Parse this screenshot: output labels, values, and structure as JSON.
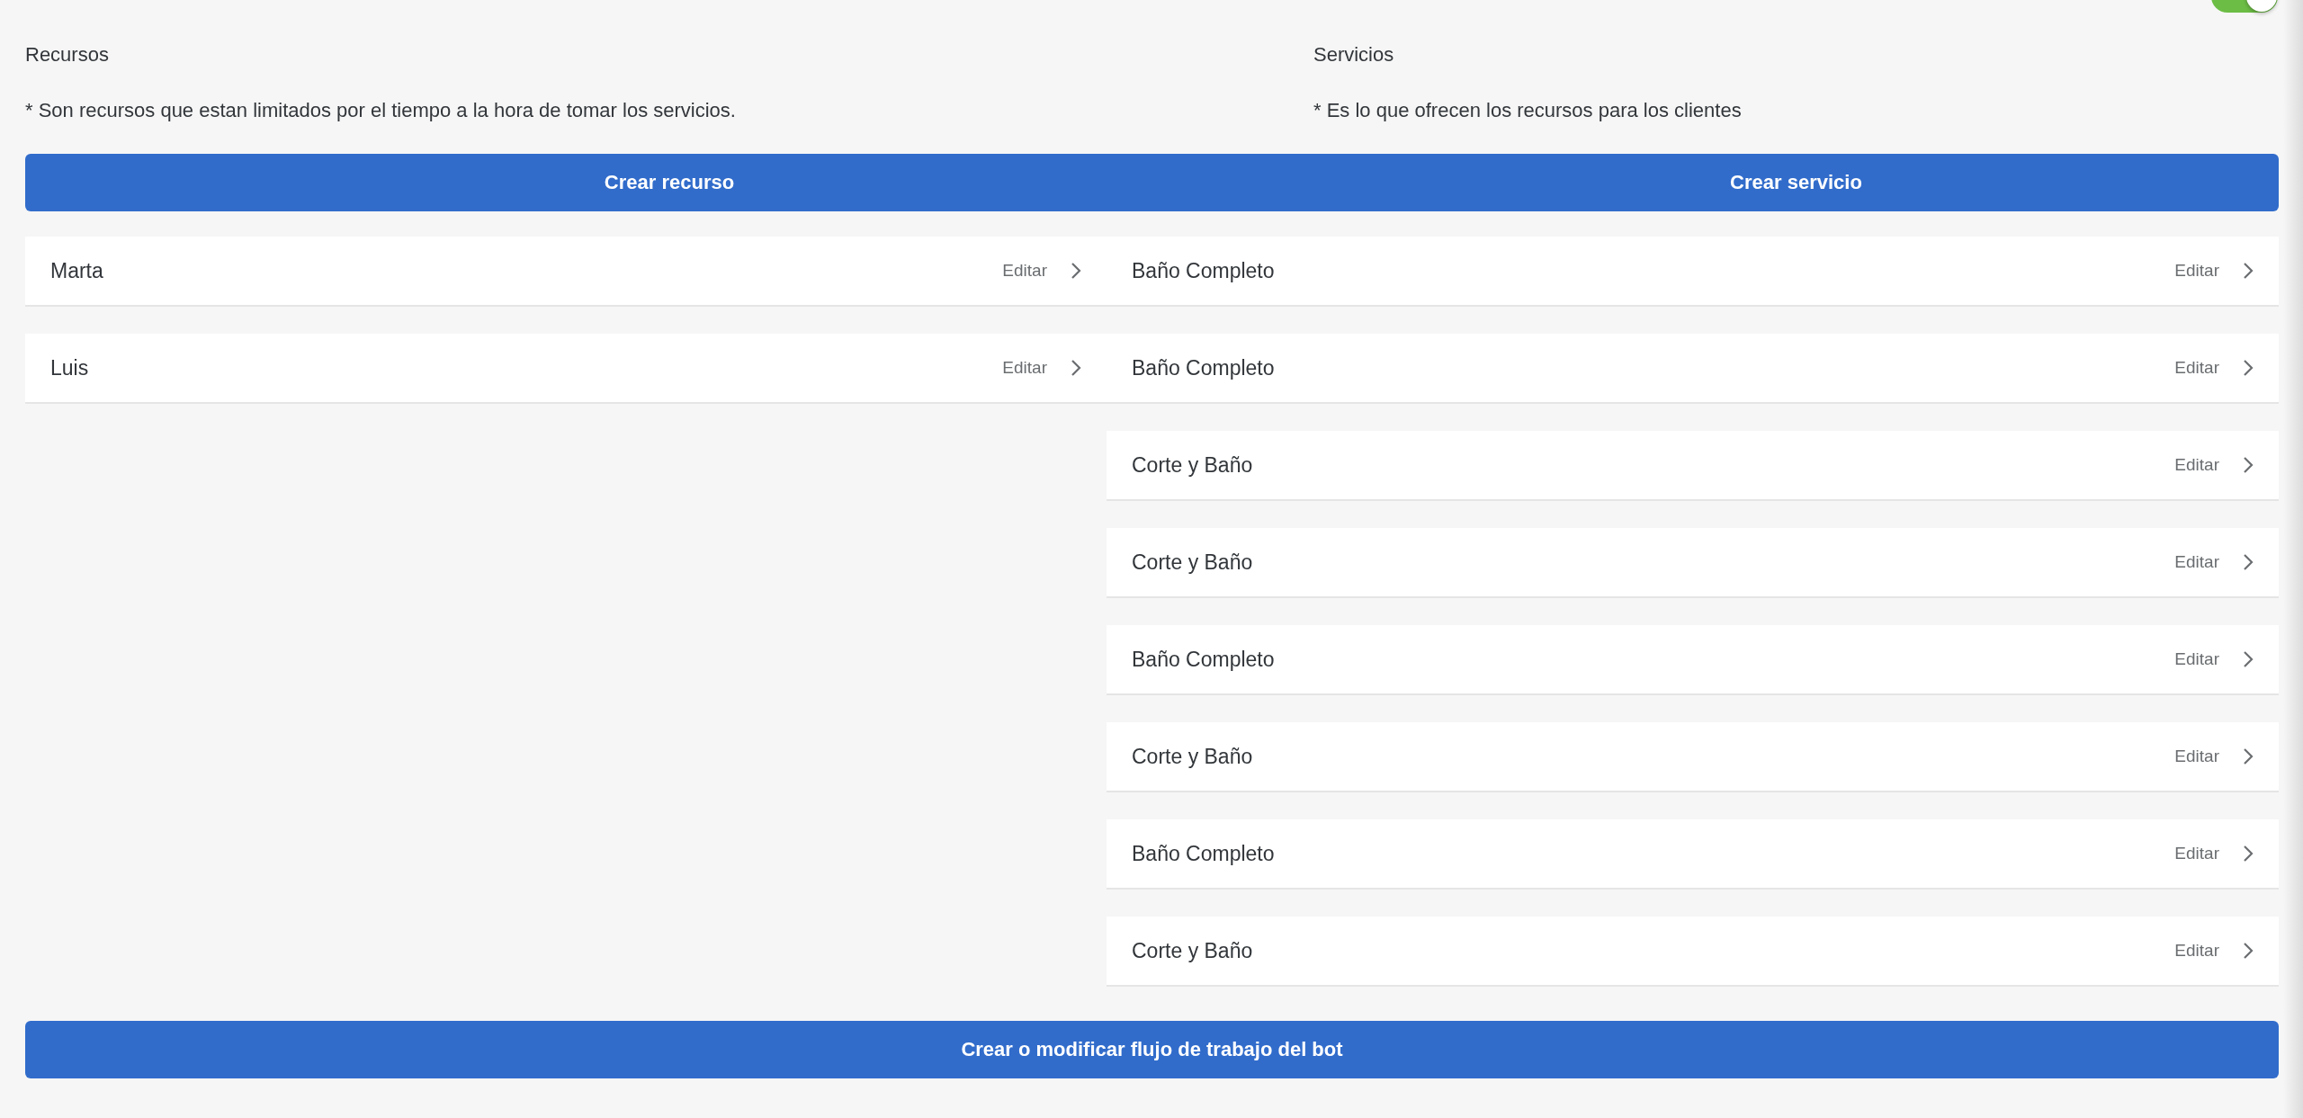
{
  "toggle": {
    "on": true
  },
  "resources": {
    "title": "Recursos",
    "note": "* Son recursos que estan limitados por el tiempo a la hora de tomar los servicios.",
    "create_button": "Crear recurso",
    "items": [
      {
        "name": "Marta",
        "action": "Editar"
      },
      {
        "name": "Luis",
        "action": "Editar"
      }
    ]
  },
  "services": {
    "title": "Servicios",
    "note": "* Es lo que ofrecen los recursos para los clientes",
    "create_button": "Crear servicio",
    "items": [
      {
        "name": "Baño Completo",
        "action": "Editar"
      },
      {
        "name": "Baño Completo",
        "action": "Editar"
      },
      {
        "name": "Corte y Baño",
        "action": "Editar"
      },
      {
        "name": "Corte y Baño",
        "action": "Editar"
      },
      {
        "name": "Baño Completo",
        "action": "Editar"
      },
      {
        "name": "Corte y Baño",
        "action": "Editar"
      },
      {
        "name": "Baño Completo",
        "action": "Editar"
      },
      {
        "name": "Corte y Baño",
        "action": "Editar"
      }
    ]
  },
  "bot_button": "Crear o modificar flujo de trabajo del bot"
}
